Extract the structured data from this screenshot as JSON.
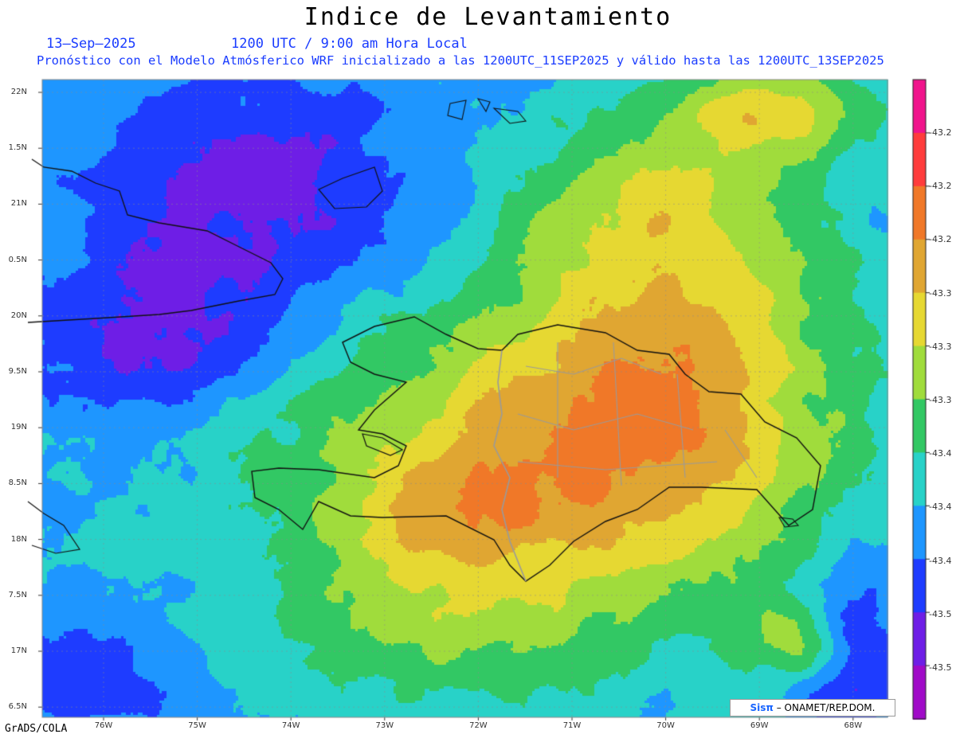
{
  "title": "Indice de Levantamiento",
  "date": "13–Sep–2025",
  "time": "1200 UTC / 9:00 am Hora Local",
  "subtitle": "Pronóstico con el Modelo Atmósferico WRF inicializado a las 1200UTC_11SEP2025 y válido hasta las  1200UTC_13SEP2025",
  "footer": "GrADS/COLA",
  "credit": {
    "logo": "Sisπ",
    "text": " – ONAMET/REP.DOM."
  },
  "axes": {
    "lat_labels": [
      "22N",
      "1.5N",
      "21N",
      "0.5N",
      "20N",
      "9.5N",
      "19N",
      "8.5N",
      "18N",
      "7.5N",
      "17N",
      "6.5N"
    ],
    "lon_labels": [
      "76W",
      "75W",
      "74W",
      "73W",
      "72W",
      "71W",
      "70W",
      "69W",
      "68W"
    ]
  },
  "colorbar": {
    "labels": [
      "-43.2",
      "-43.2",
      "-43.2",
      "-43.3",
      "-43.3",
      "-43.3",
      "-43.4",
      "-43.4",
      "-43.4",
      "-43.5",
      "-43.5"
    ],
    "colors": [
      "#f0148c",
      "#ff3c3c",
      "#f07828",
      "#e0a632",
      "#e6d832",
      "#a0dc3c",
      "#32c864",
      "#28d2c8",
      "#1e96ff",
      "#1e3cff",
      "#6e1ee6",
      "#a00ac8"
    ]
  }
}
